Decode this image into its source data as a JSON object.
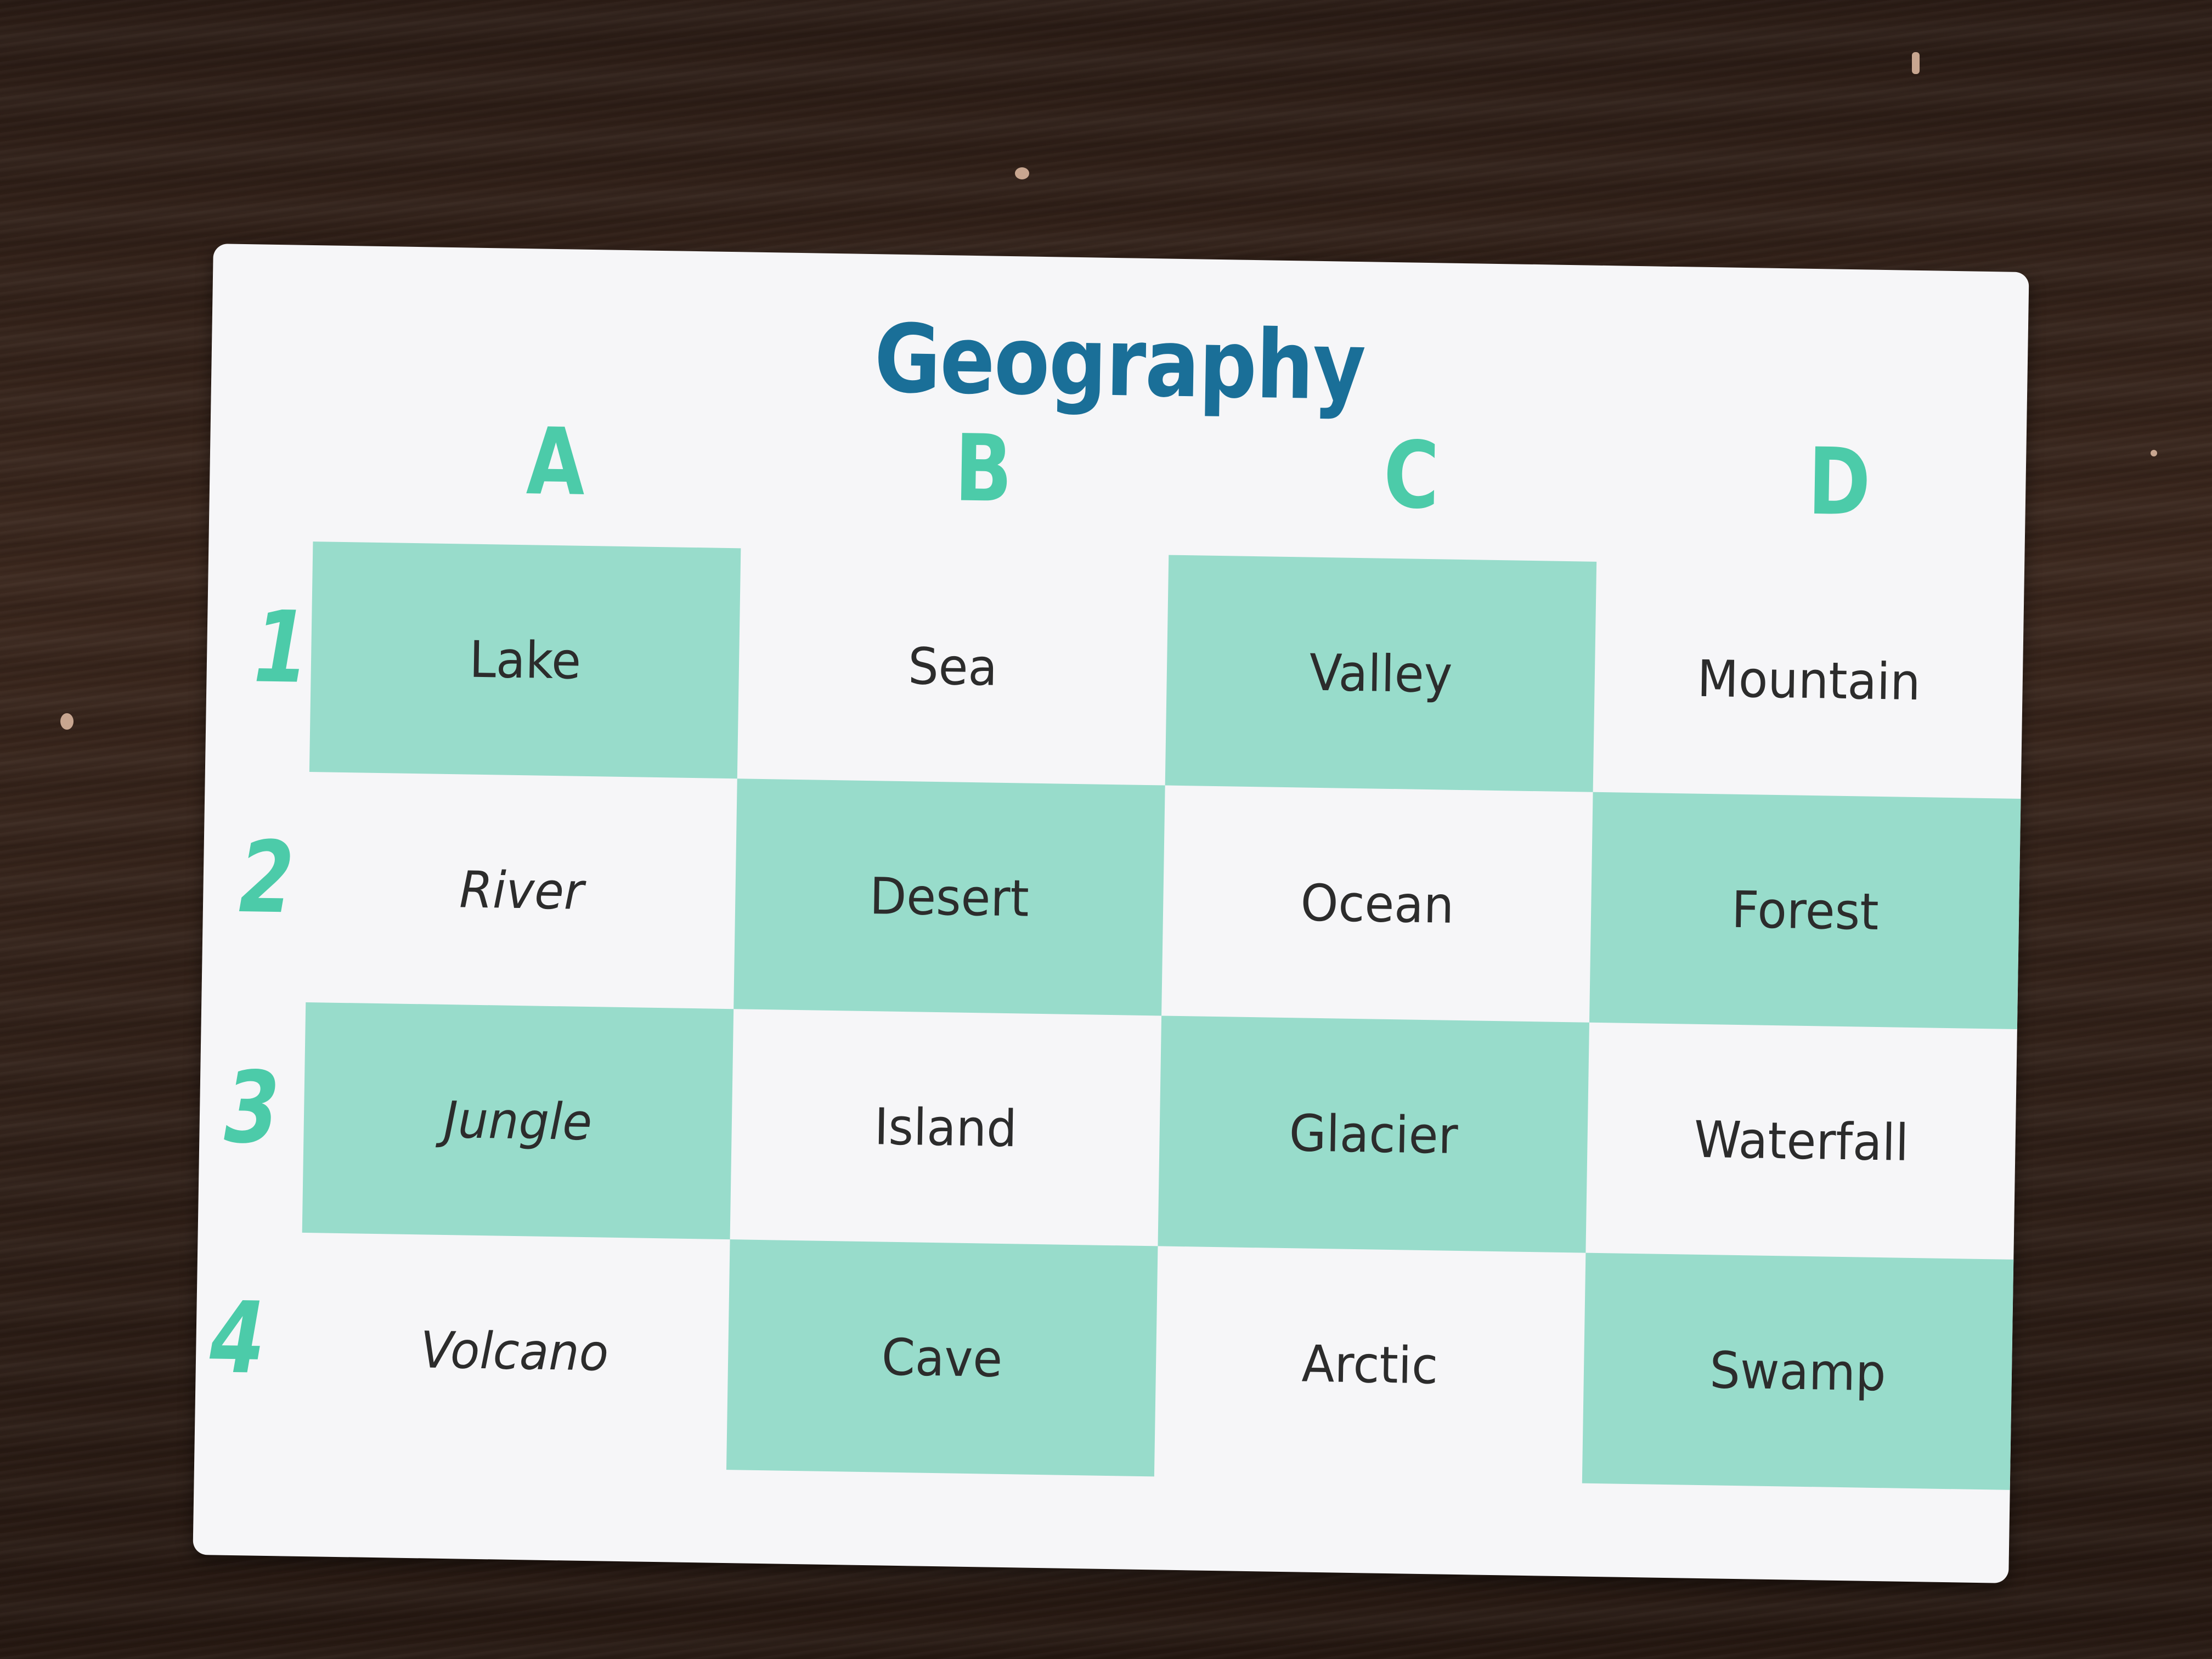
{
  "card": {
    "title": "Geography",
    "columns": [
      "A",
      "B",
      "C",
      "D"
    ],
    "rows": [
      {
        "label": "1",
        "cells": [
          "Lake",
          "Sea",
          "Valley",
          "Mountain"
        ]
      },
      {
        "label": "2",
        "cells": [
          "River",
          "Desert",
          "Ocean",
          "Forest"
        ]
      },
      {
        "label": "3",
        "cells": [
          "Jungle",
          "Island",
          "Glacier",
          "Waterfall"
        ]
      },
      {
        "label": "4",
        "cells": [
          "Volcano",
          "Cave",
          "Arctic",
          "Swamp"
        ]
      }
    ]
  },
  "colors": {
    "title": "#1a6f98",
    "heading": "#4ccba9",
    "teal_cell": "#98dccb",
    "card": "#f6f6f8",
    "table": "#3a261c"
  }
}
